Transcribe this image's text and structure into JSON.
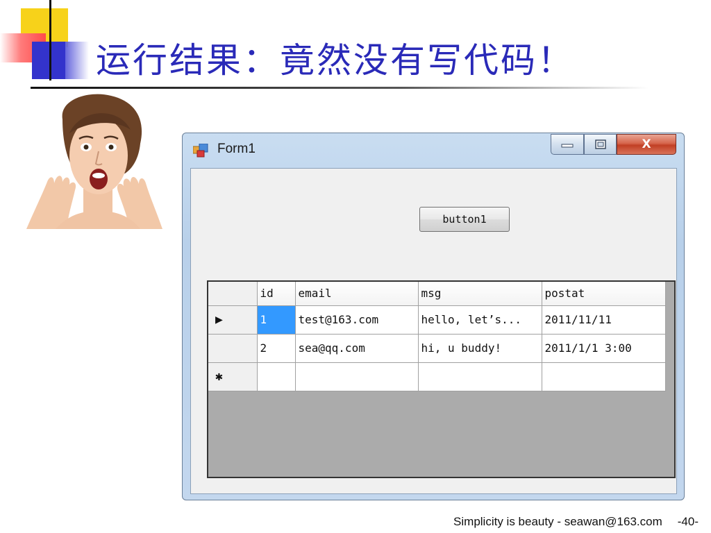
{
  "slide": {
    "title": "运行结果：竟然没有写代码！",
    "footer_text": "Simplicity is beauty - seawan@163.com",
    "page_number": "-40-"
  },
  "window": {
    "title": "Form1",
    "close_glyph": "X"
  },
  "form": {
    "button_label": "button1"
  },
  "grid": {
    "columns": [
      "id",
      "email",
      "msg",
      "postat"
    ],
    "rows": [
      {
        "marker": "▶",
        "id": "1",
        "email": "test@163.com",
        "msg": "hello, let’s...",
        "postat": "2011/11/11"
      },
      {
        "marker": "",
        "id": "2",
        "email": "sea@qq.com",
        "msg": "hi, u buddy!",
        "postat": "2011/1/1 3:00"
      },
      {
        "marker": "✱",
        "id": "",
        "email": "",
        "msg": "",
        "postat": ""
      }
    ]
  },
  "colors": {
    "title_blue": "#2a2ab8",
    "selection_blue": "#3399ff",
    "grid_background": "#ababab"
  }
}
